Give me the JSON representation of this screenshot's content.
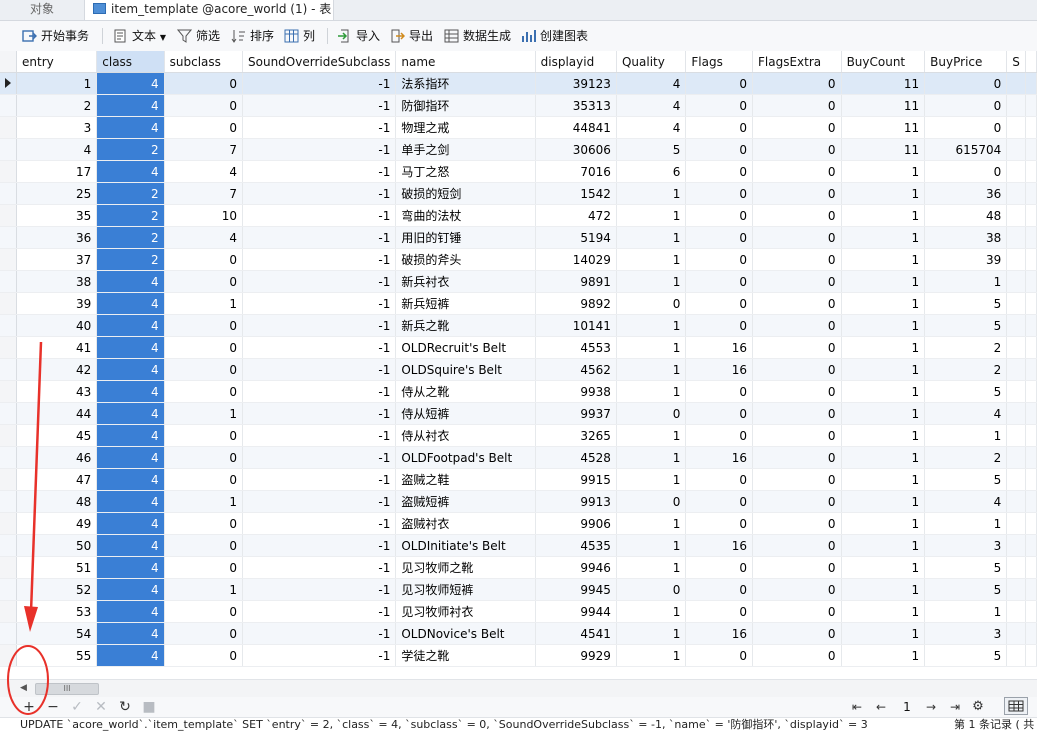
{
  "tabs": {
    "objects": "对象",
    "active": "item_template @acore_world (1) - 表"
  },
  "toolbar": {
    "begin_transaction": "开始事务",
    "text": "文本",
    "filter": "筛选",
    "sort": "排序",
    "columns": "列",
    "import": "导入",
    "export": "导出",
    "data_generate": "数据生成",
    "create_chart": "创建图表"
  },
  "columns": [
    "entry",
    "class",
    "subclass",
    "SoundOverrideSubclass",
    "name",
    "displayid",
    "Quality",
    "Flags",
    "FlagsExtra",
    "BuyCount",
    "BuyPrice",
    "S"
  ],
  "rows": [
    [
      "1",
      "4",
      "0",
      "-1",
      "法系指环",
      "39123",
      "4",
      "0",
      "0",
      "11",
      "0"
    ],
    [
      "2",
      "4",
      "0",
      "-1",
      "防御指环",
      "35313",
      "4",
      "0",
      "0",
      "11",
      "0"
    ],
    [
      "3",
      "4",
      "0",
      "-1",
      "物理之戒",
      "44841",
      "4",
      "0",
      "0",
      "11",
      "0"
    ],
    [
      "4",
      "2",
      "7",
      "-1",
      "单手之剑",
      "30606",
      "5",
      "0",
      "0",
      "11",
      "615704"
    ],
    [
      "17",
      "4",
      "4",
      "-1",
      "马丁之怒",
      "7016",
      "6",
      "0",
      "0",
      "1",
      "0"
    ],
    [
      "25",
      "2",
      "7",
      "-1",
      "破损的短剑",
      "1542",
      "1",
      "0",
      "0",
      "1",
      "36"
    ],
    [
      "35",
      "2",
      "10",
      "-1",
      "弯曲的法杖",
      "472",
      "1",
      "0",
      "0",
      "1",
      "48"
    ],
    [
      "36",
      "2",
      "4",
      "-1",
      "用旧的钉锤",
      "5194",
      "1",
      "0",
      "0",
      "1",
      "38"
    ],
    [
      "37",
      "2",
      "0",
      "-1",
      "破损的斧头",
      "14029",
      "1",
      "0",
      "0",
      "1",
      "39"
    ],
    [
      "38",
      "4",
      "0",
      "-1",
      "新兵衬衣",
      "9891",
      "1",
      "0",
      "0",
      "1",
      "1"
    ],
    [
      "39",
      "4",
      "1",
      "-1",
      "新兵短裤",
      "9892",
      "0",
      "0",
      "0",
      "1",
      "5"
    ],
    [
      "40",
      "4",
      "0",
      "-1",
      "新兵之靴",
      "10141",
      "1",
      "0",
      "0",
      "1",
      "5"
    ],
    [
      "41",
      "4",
      "0",
      "-1",
      "OLDRecruit's Belt",
      "4553",
      "1",
      "16",
      "0",
      "1",
      "2"
    ],
    [
      "42",
      "4",
      "0",
      "-1",
      "OLDSquire's Belt",
      "4562",
      "1",
      "16",
      "0",
      "1",
      "2"
    ],
    [
      "43",
      "4",
      "0",
      "-1",
      "侍从之靴",
      "9938",
      "1",
      "0",
      "0",
      "1",
      "5"
    ],
    [
      "44",
      "4",
      "1",
      "-1",
      "侍从短裤",
      "9937",
      "0",
      "0",
      "0",
      "1",
      "4"
    ],
    [
      "45",
      "4",
      "0",
      "-1",
      "侍从衬衣",
      "3265",
      "1",
      "0",
      "0",
      "1",
      "1"
    ],
    [
      "46",
      "4",
      "0",
      "-1",
      "OLDFootpad's Belt",
      "4528",
      "1",
      "16",
      "0",
      "1",
      "2"
    ],
    [
      "47",
      "4",
      "0",
      "-1",
      "盗贼之鞋",
      "9915",
      "1",
      "0",
      "0",
      "1",
      "5"
    ],
    [
      "48",
      "4",
      "1",
      "-1",
      "盗贼短裤",
      "9913",
      "0",
      "0",
      "0",
      "1",
      "4"
    ],
    [
      "49",
      "4",
      "0",
      "-1",
      "盗贼衬衣",
      "9906",
      "1",
      "0",
      "0",
      "1",
      "1"
    ],
    [
      "50",
      "4",
      "0",
      "-1",
      "OLDInitiate's Belt",
      "4535",
      "1",
      "16",
      "0",
      "1",
      "3"
    ],
    [
      "51",
      "4",
      "0",
      "-1",
      "见习牧师之靴",
      "9946",
      "1",
      "0",
      "0",
      "1",
      "5"
    ],
    [
      "52",
      "4",
      "1",
      "-1",
      "见习牧师短裤",
      "9945",
      "0",
      "0",
      "0",
      "1",
      "5"
    ],
    [
      "53",
      "4",
      "0",
      "-1",
      "见习牧师衬衣",
      "9944",
      "1",
      "0",
      "0",
      "1",
      "1"
    ],
    [
      "54",
      "4",
      "0",
      "-1",
      "OLDNovice's Belt",
      "4541",
      "1",
      "16",
      "0",
      "1",
      "3"
    ],
    [
      "55",
      "4",
      "0",
      "-1",
      "学徒之靴",
      "9929",
      "1",
      "0",
      "0",
      "1",
      "5"
    ]
  ],
  "pager": {
    "page": "1"
  },
  "status": {
    "sql": "UPDATE `acore_world`.`item_template` SET `entry` = 2, `class` = 4, `subclass` = 0, `SoundOverrideSubclass` = -1, `name` = '防御指环', `displayid` = 3",
    "records": "第 1 条记录 ( 共"
  },
  "scrollbar": {
    "thumb_glyph": "III"
  },
  "colors": {
    "selected_column": "#3a7fd5",
    "annotation": "#e8312a"
  }
}
